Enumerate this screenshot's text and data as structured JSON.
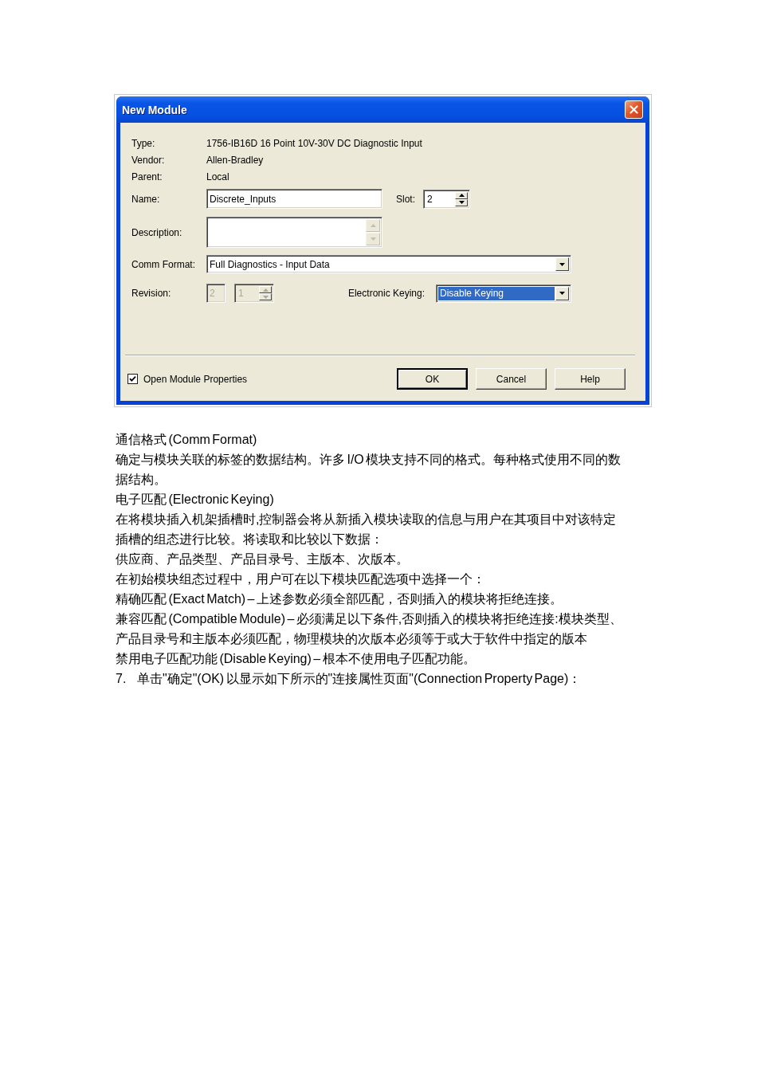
{
  "dialog": {
    "title": "New Module",
    "info": [
      {
        "label": "Type:",
        "value": "1756-IB16D 16 Point 10V-30V DC Diagnostic Input"
      },
      {
        "label": "Vendor:",
        "value": "Allen-Bradley"
      },
      {
        "label": "Parent:",
        "value": "Local"
      }
    ],
    "name": {
      "label": "Name:",
      "value": "Discrete_Inputs"
    },
    "slot": {
      "label": "Slot:",
      "value": "2"
    },
    "description": {
      "label": "Description:"
    },
    "comm_format": {
      "label": "Comm Format:",
      "value": "Full Diagnostics - Input Data"
    },
    "revision": {
      "label": "Revision:",
      "major": "2",
      "minor": "1",
      "disabled": true
    },
    "electronic_keying": {
      "label": "Electronic Keying:",
      "value": "Disable Keying",
      "highlighted": true
    },
    "open_module_properties": {
      "label": "Open Module Properties",
      "checked": true
    },
    "buttons": [
      {
        "label": "OK",
        "default": true
      },
      {
        "label": "Cancel",
        "default": false
      },
      {
        "label": "Help",
        "default": false
      }
    ]
  },
  "document": {
    "paragraphs": [
      "通信格式 (Comm Format)",
      "确定与模块关联的标签的数据结构。许多 I/O 模块支持不同的格式。每种格式使用不同的数据结构。",
      "电子匹配 (Electronic Keying)",
      "在将模块插入机架插槽时,控制器会将从新插入模块读取的信息与用户在其项目中对该特定插槽的组态进行比较。将读取和比较以下数据：",
      "供应商、产品类型、产品目录号、主版本、次版本。",
      "在初始模块组态过程中，用户可在以下模块匹配选项中选择一个：",
      "精确匹配 (Exact Match) – 上述参数必须全部匹配，否则插入的模块将拒绝连接。",
      "兼容匹配 (Compatible Module) – 必须满足以下条件,否则插入的模块将拒绝连接:模块类型、产品目录号和主版本必须匹配，物理模块的次版本必须等于或大于软件中指定的版本",
      "禁用电子匹配功能 (Disable Keying) – 根本不使用电子匹配功能。"
    ],
    "list_item": {
      "number": "7.",
      "text": "单击\"确定\"(OK) 以显示如下所示的\"连接属性页面\"(Connection Property Page)："
    }
  }
}
